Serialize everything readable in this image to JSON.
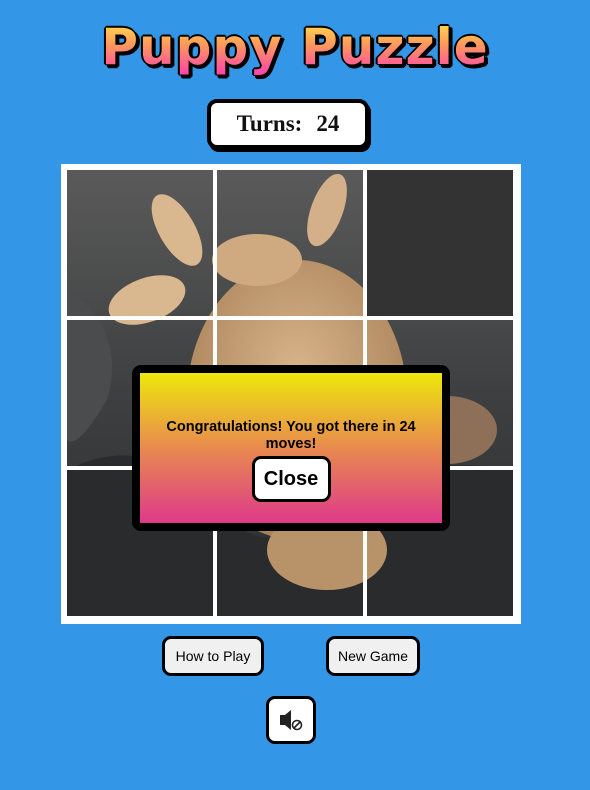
{
  "app": {
    "title": "Puppy Puzzle"
  },
  "turns": {
    "label": "Turns:",
    "count": "24"
  },
  "board": {
    "grid": "3x3",
    "empty_tile": {
      "row": 0,
      "col": 2
    },
    "tile_color_empty": "#333333"
  },
  "modal": {
    "message": "Congratulations! You got there in 24 moves!",
    "close_label": "Close"
  },
  "controls": {
    "how_to_play_label": "How to Play",
    "new_game_label": "New Game",
    "sound_icon": "speaker-muted-icon"
  },
  "colors": {
    "background": "#3396e6",
    "modal_gradient_top": "#ede80c",
    "modal_gradient_bottom": "#de3a8a"
  }
}
